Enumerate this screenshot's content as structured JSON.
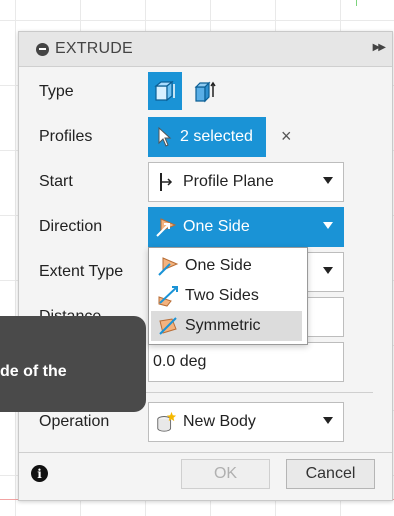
{
  "header": {
    "title": "EXTRUDE"
  },
  "fields": {
    "type_label": "Type",
    "profiles_label": "Profiles",
    "profiles_value": "2 selected",
    "profiles_clear": "×",
    "start_label": "Start",
    "start_value": "Profile Plane",
    "direction_label": "Direction",
    "direction_value": "One Side",
    "extent_type_label": "Extent Type",
    "distance_label": "Distance",
    "angle_value": "0.0 deg",
    "operation_label": "Operation",
    "operation_value": "New Body"
  },
  "direction_menu": {
    "options": [
      "One Side",
      "Two Sides",
      "Symmetric"
    ],
    "highlighted": "Symmetric"
  },
  "tooltip": {
    "text": "de of the"
  },
  "footer": {
    "info": "i",
    "ok_label": "OK",
    "cancel_label": "Cancel"
  },
  "colors": {
    "accent": "#1a93d6",
    "panel": "#f4f4f4",
    "tooltip": "#4a4a4a"
  },
  "icons": {
    "header": "collapse-icon",
    "expand": "expand-icon",
    "type_one": "solid-extrude-icon",
    "type_two": "thin-extrude-icon",
    "profiles": "cursor-icon",
    "start": "profile-plane-icon",
    "direction": "one-side-icon",
    "operation": "new-body-icon",
    "info": "info-icon"
  }
}
